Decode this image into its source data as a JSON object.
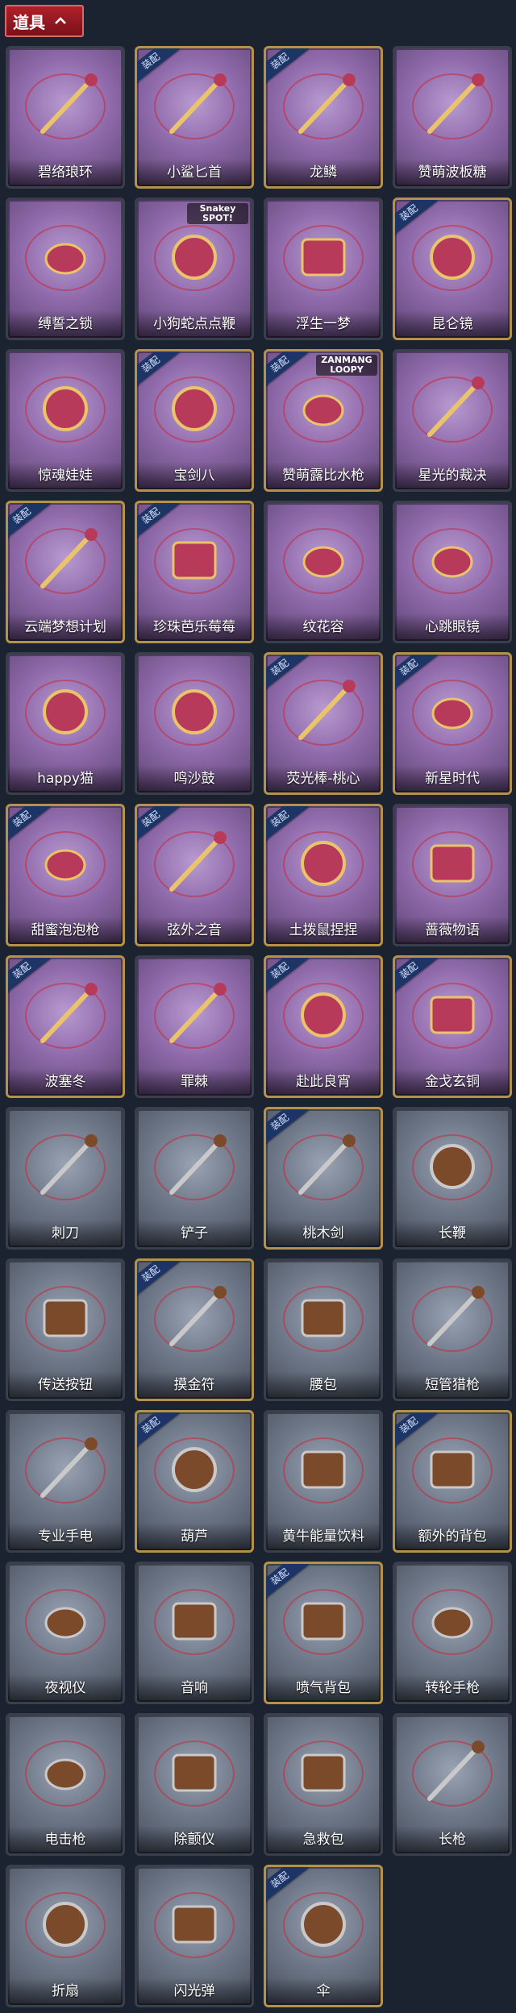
{
  "header": {
    "title": "道具",
    "toggle_icon": "chevron-up-icon"
  },
  "badge_label": "装配",
  "items": [
    {
      "name": "碧络琅环",
      "theme": "purple",
      "badge": false,
      "icon": "ring-accessory-icon"
    },
    {
      "name": "小鲨匕首",
      "theme": "purple",
      "badge": true,
      "icon": "shark-dagger-icon"
    },
    {
      "name": "龙鳞",
      "theme": "purple",
      "badge": true,
      "icon": "golden-key-icon"
    },
    {
      "name": "赞萌波板糖",
      "theme": "purple",
      "badge": false,
      "icon": "lollipop-icon"
    },
    {
      "name": "缚誓之锁",
      "theme": "purple",
      "badge": false,
      "icon": "lock-chain-icon"
    },
    {
      "name": "小狗蛇点点鞭",
      "theme": "purple",
      "badge": false,
      "icon": "snake-whip-icon",
      "corner_text": "Snakey SPOT!"
    },
    {
      "name": "浮生一梦",
      "theme": "purple",
      "badge": false,
      "icon": "scroll-icon"
    },
    {
      "name": "昆仑镜",
      "theme": "purple",
      "badge": true,
      "icon": "mirror-icon"
    },
    {
      "name": "惊魂娃娃",
      "theme": "purple",
      "badge": false,
      "icon": "doll-head-icon"
    },
    {
      "name": "宝剑八",
      "theme": "purple",
      "badge": true,
      "icon": "heart-mirror-icon"
    },
    {
      "name": "赞萌露比水枪",
      "theme": "purple",
      "badge": true,
      "icon": "water-gun-icon",
      "corner_text": "ZANMANG LOOPY"
    },
    {
      "name": "星光的裁决",
      "theme": "purple",
      "badge": false,
      "icon": "shotgun-icon"
    },
    {
      "name": "云端梦想计划",
      "theme": "purple",
      "badge": true,
      "icon": "rocket-wand-icon"
    },
    {
      "name": "珍珠芭乐莓莓",
      "theme": "purple",
      "badge": true,
      "icon": "drink-cup-icon"
    },
    {
      "name": "纹花容",
      "theme": "purple",
      "badge": false,
      "icon": "hairpin-icon"
    },
    {
      "name": "心跳眼镜",
      "theme": "purple",
      "badge": false,
      "icon": "heart-glasses-icon"
    },
    {
      "name": "happy猫",
      "theme": "purple",
      "badge": false,
      "icon": "cat-figure-icon"
    },
    {
      "name": "鸣沙鼓",
      "theme": "purple",
      "badge": false,
      "icon": "drum-clock-icon"
    },
    {
      "name": "荧光棒-桃心",
      "theme": "purple",
      "badge": true,
      "icon": "heart-wand-icon"
    },
    {
      "name": "新星时代",
      "theme": "purple",
      "badge": true,
      "icon": "revolver-gold-icon"
    },
    {
      "name": "甜蜜泡泡枪",
      "theme": "purple",
      "badge": true,
      "icon": "bubble-gun-icon"
    },
    {
      "name": "弦外之音",
      "theme": "purple",
      "badge": true,
      "icon": "lute-icon"
    },
    {
      "name": "土拨鼠捏捏",
      "theme": "purple",
      "badge": true,
      "icon": "hamster-icon"
    },
    {
      "name": "蔷薇物语",
      "theme": "purple",
      "badge": false,
      "icon": "medkit-red-icon"
    },
    {
      "name": "波塞冬",
      "theme": "purple",
      "badge": true,
      "icon": "trident-icon"
    },
    {
      "name": "罪棘",
      "theme": "purple",
      "badge": false,
      "icon": "spear-thorn-icon"
    },
    {
      "name": "赴此良宵",
      "theme": "purple",
      "badge": true,
      "icon": "fan-lamp-icon"
    },
    {
      "name": "金戈玄铜",
      "theme": "purple",
      "badge": true,
      "icon": "bronze-lantern-icon"
    },
    {
      "name": "刺刀",
      "theme": "gray",
      "badge": false,
      "icon": "knife-icon"
    },
    {
      "name": "铲子",
      "theme": "gray",
      "badge": false,
      "icon": "shovel-icon"
    },
    {
      "name": "桃木剑",
      "theme": "gray",
      "badge": true,
      "icon": "wooden-sword-icon"
    },
    {
      "name": "长鞭",
      "theme": "gray",
      "badge": false,
      "icon": "whip-icon"
    },
    {
      "name": "传送按钮",
      "theme": "gray",
      "badge": false,
      "icon": "remote-button-icon"
    },
    {
      "name": "摸金符",
      "theme": "gray",
      "badge": true,
      "icon": "tooth-charm-icon"
    },
    {
      "name": "腰包",
      "theme": "gray",
      "badge": false,
      "icon": "waist-bag-icon"
    },
    {
      "name": "短管猎枪",
      "theme": "gray",
      "badge": false,
      "icon": "sawed-off-icon"
    },
    {
      "name": "专业手电",
      "theme": "gray",
      "badge": false,
      "icon": "flashlight-icon"
    },
    {
      "name": "葫芦",
      "theme": "gray",
      "badge": true,
      "icon": "gourd-icon"
    },
    {
      "name": "黄牛能量饮料",
      "theme": "gray",
      "badge": false,
      "icon": "energy-can-icon"
    },
    {
      "name": "额外的背包",
      "theme": "gray",
      "badge": true,
      "icon": "backpack-icon"
    },
    {
      "name": "夜视仪",
      "theme": "gray",
      "badge": false,
      "icon": "goggles-icon"
    },
    {
      "name": "音响",
      "theme": "gray",
      "badge": false,
      "icon": "boombox-icon"
    },
    {
      "name": "喷气背包",
      "theme": "gray",
      "badge": true,
      "icon": "jetpack-icon"
    },
    {
      "name": "转轮手枪",
      "theme": "gray",
      "badge": false,
      "icon": "revolver-icon"
    },
    {
      "name": "电击枪",
      "theme": "gray",
      "badge": false,
      "icon": "stun-gun-icon"
    },
    {
      "name": "除颤仪",
      "theme": "gray",
      "badge": false,
      "icon": "defibrillator-icon"
    },
    {
      "name": "急救包",
      "theme": "gray",
      "badge": false,
      "icon": "first-aid-icon"
    },
    {
      "name": "长枪",
      "theme": "gray",
      "badge": false,
      "icon": "long-spear-icon"
    },
    {
      "name": "折扇",
      "theme": "gray",
      "badge": false,
      "icon": "folding-fan-icon"
    },
    {
      "name": "闪光弹",
      "theme": "gray",
      "badge": false,
      "icon": "flashbang-icon"
    },
    {
      "name": "伞",
      "theme": "gray",
      "badge": true,
      "icon": "umbrella-icon"
    }
  ]
}
